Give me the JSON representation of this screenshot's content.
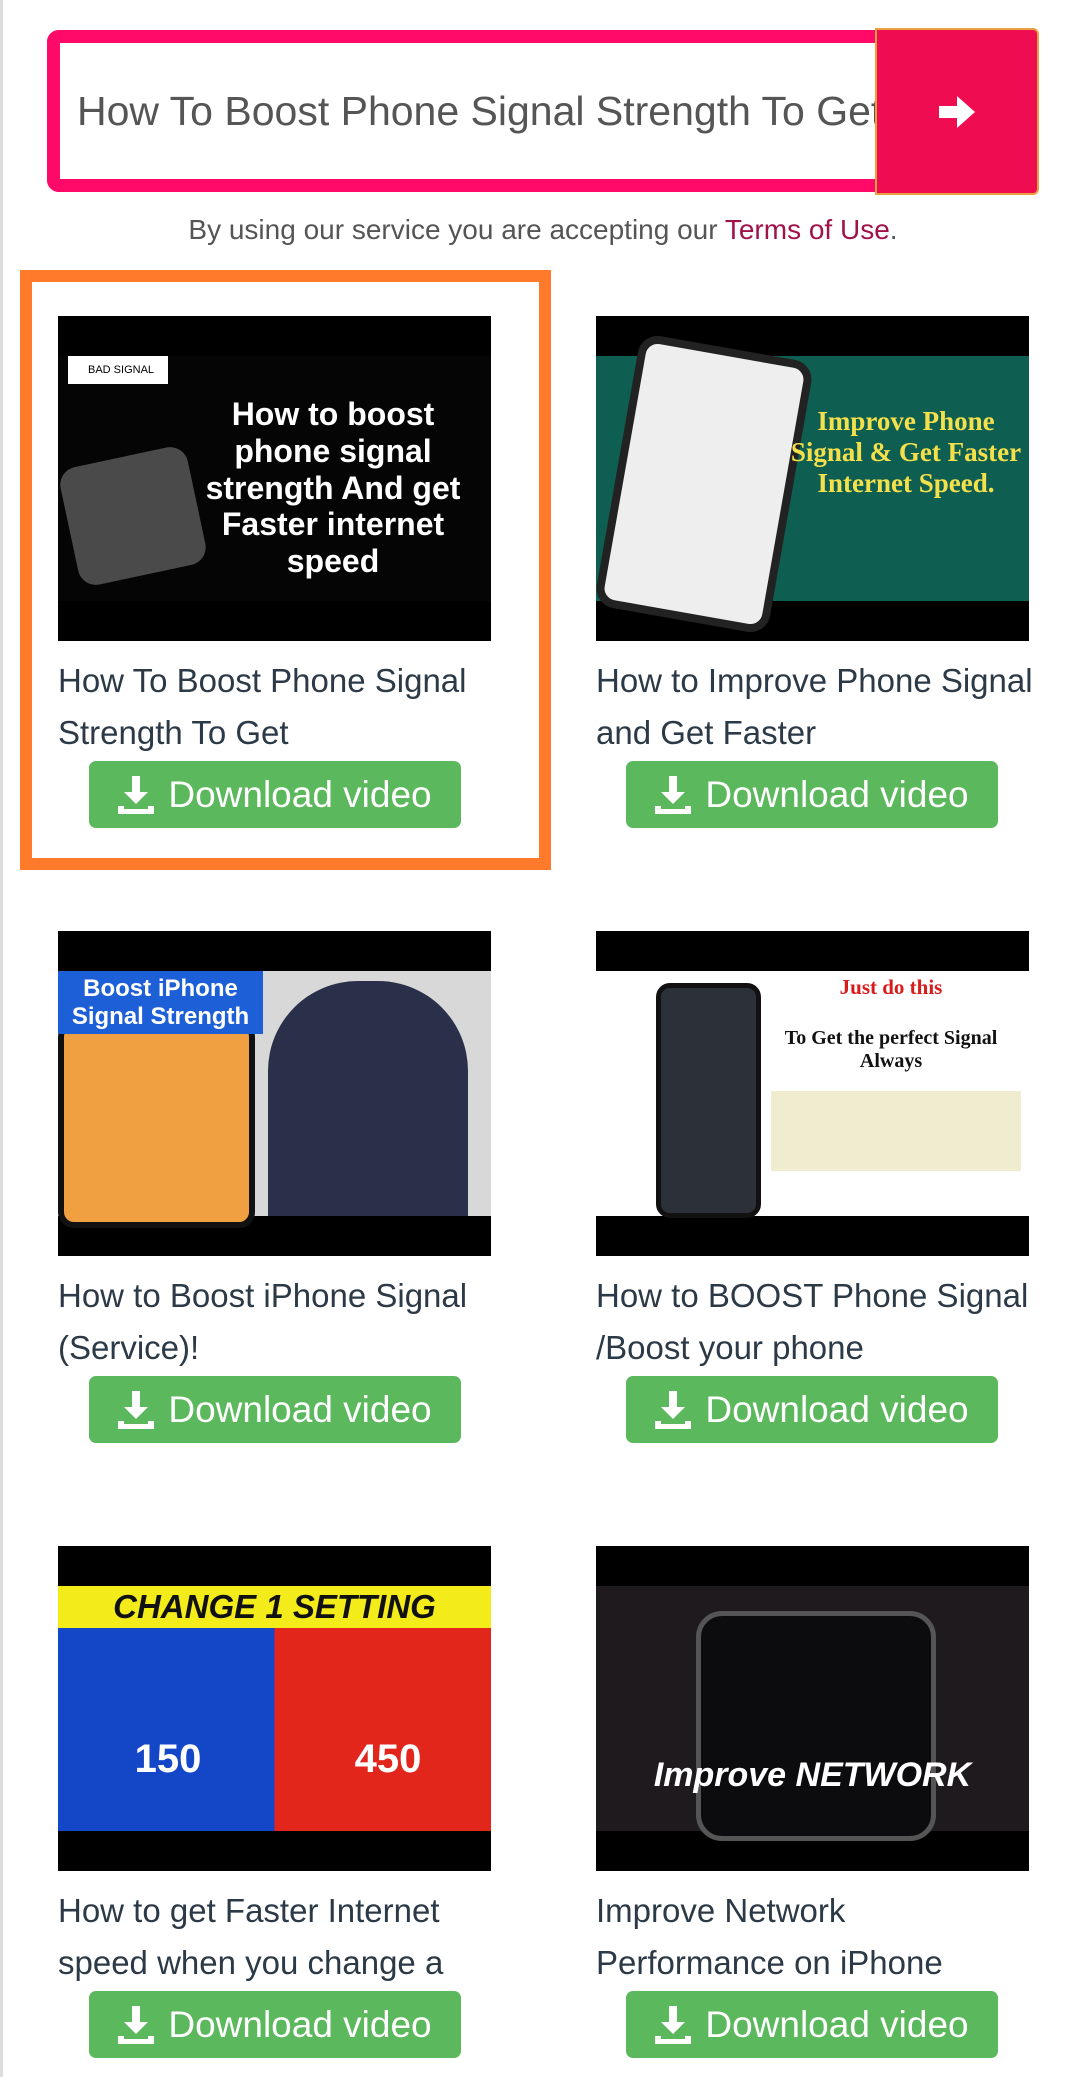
{
  "search": {
    "value": "How To Boost Phone Signal Strength To Get Faster Internet Speed",
    "button_icon": "arrow-right-icon"
  },
  "terms": {
    "prefix": "By using our service you are accepting our ",
    "link": "Terms of Use",
    "suffix": "."
  },
  "colors": {
    "search_border": "#ff0a68",
    "search_button": "#f00c50",
    "highlight": "#ff7a2a",
    "download": "#5cb85c"
  },
  "videos": [
    {
      "title": "How To Boost Phone Signal Strength To Get",
      "thumb_text": "How to boost phone signal strength And get Faster internet speed",
      "thumb_badge": "BAD SIGNAL",
      "download": "Download video"
    },
    {
      "title": "How to Improve Phone Signal and Get Faster",
      "thumb_text": "Improve Phone Signal & Get Faster Internet Speed.",
      "download": "Download video"
    },
    {
      "title": "How to Boost iPhone Signal (Service)!",
      "thumb_text": "Boost iPhone Signal Strength",
      "download": "Download video"
    },
    {
      "title": "How to BOOST Phone Signal /Boost your phone",
      "thumb_text": "Just do this",
      "thumb_text2": "To Get the perfect Signal Always",
      "download": "Download video"
    },
    {
      "title": "How to get Faster Internet speed when you change a",
      "thumb_text": "CHANGE 1 SETTING",
      "thumb_text2": "150",
      "thumb_text3": "450",
      "download": "Download video"
    },
    {
      "title": "Improve Network Performance on iPhone",
      "thumb_text": "Improve NETWORK",
      "download": "Download video"
    }
  ]
}
